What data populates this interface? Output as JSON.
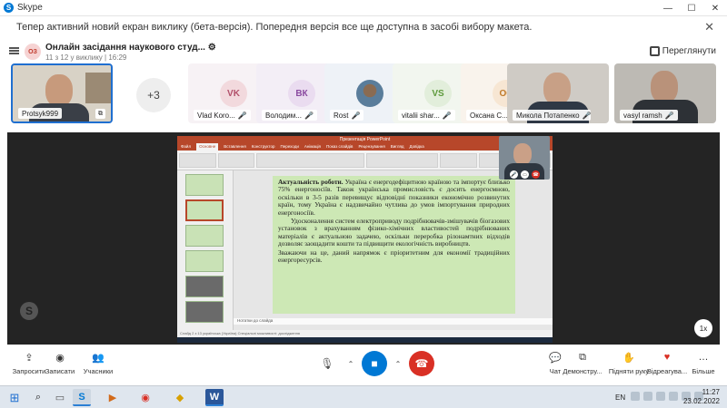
{
  "window": {
    "title": "Skype",
    "minimize": "—",
    "maximize": "☐",
    "close": "✕"
  },
  "notice": {
    "text": "Тепер активний новий екран виклику (бета-версія). Попередня версія все ще доступна в засобі вибору макета.",
    "close": "✕"
  },
  "header": {
    "avatar_initials": "ОЗ",
    "title": "Онлайн засідання наукового студ...",
    "settings_glyph": "⚙",
    "subtitle": "11 з 12 у виклику | 16:29",
    "view_label": "Переглянути"
  },
  "tiles": [
    {
      "name": "Protsyk999",
      "kind": "video"
    },
    {
      "name": "",
      "kind": "more",
      "label": "+3"
    },
    {
      "name": "Vlad Koro...",
      "initials": "VK",
      "kind": "initials",
      "bg": "#f2d9dd",
      "fg": "#b2506a"
    },
    {
      "name": "Володим...",
      "initials": "ВК",
      "kind": "initials",
      "bg": "#eadcf0",
      "fg": "#8a4aa0"
    },
    {
      "name": "Rost",
      "kind": "avatar"
    },
    {
      "name": "vitalii shar...",
      "initials": "VS",
      "kind": "initials",
      "bg": "#e2eedb",
      "fg": "#5e9a3c"
    },
    {
      "name": "Оксана С...",
      "initials": "ОС",
      "kind": "initials",
      "bg": "#f7e6d3",
      "fg": "#c07a2a"
    },
    {
      "name": "Микола Потапенко",
      "kind": "video"
    },
    {
      "name": "vasyl ramsh",
      "kind": "video"
    }
  ],
  "powerpoint": {
    "title": "Презентація PowerPoint",
    "tabs": [
      "Файл",
      "Основне",
      "Вставлення",
      "Конструктор",
      "Переходи",
      "Анімація",
      "Показ слайдів",
      "Рецензування",
      "Вигляд",
      "Довідка"
    ],
    "notes": "Нотатки до слайда",
    "status": "Слайд 2 з 13   українська (Україна)   Спеціальні можливості: дослідження"
  },
  "slide": {
    "heading": "Актуальність роботи.",
    "p1": "Україна є енергодефіцитною країною та імпортує близько 75% енергоносіїв. Також українська промисловість є досить енергоємною, оскільки в 3-5 разів перевищує відповідні показники економічно розвинутих країн, тому Україна є надзвичайно чутлива до умов імпортування природних енергоносіїв.",
    "p2": "Удосконалення систем електроприводу подрібнювачів-змішувачів біогазових установок з врахуванням фізико-хімічних властивостей подрібнюваних матеріалів є актуальною задачею, оскільки переробка рілонамтних відходів дозволяє заощадити кошти та підвищити екологічність виробництв.",
    "p3": "Зважаючи на це, даний напрямок є пріоритетним для економії традиційних енергоресурсів."
  },
  "stage": {
    "zoom_badge": "1x"
  },
  "controls": {
    "left": [
      {
        "label": "Запросити",
        "glyph": "⇪"
      },
      {
        "label": "Записати",
        "glyph": "◉"
      },
      {
        "label": "Учасники",
        "glyph": "👥"
      }
    ],
    "right": [
      {
        "label": "Чат",
        "glyph": "💬"
      },
      {
        "label": "Демонстру...",
        "glyph": "⧉"
      },
      {
        "label": "Підняти руку",
        "glyph": "✋"
      },
      {
        "label": "Відреагува...",
        "glyph": "♥"
      },
      {
        "label": "Більше",
        "glyph": "…"
      }
    ],
    "mic_glyph": "🎙",
    "video_glyph": "■",
    "hangup_glyph": "☎",
    "caret": "⌃"
  },
  "taskbar": {
    "lang": "EN",
    "time": "11:27",
    "date": "23.02.2022"
  }
}
